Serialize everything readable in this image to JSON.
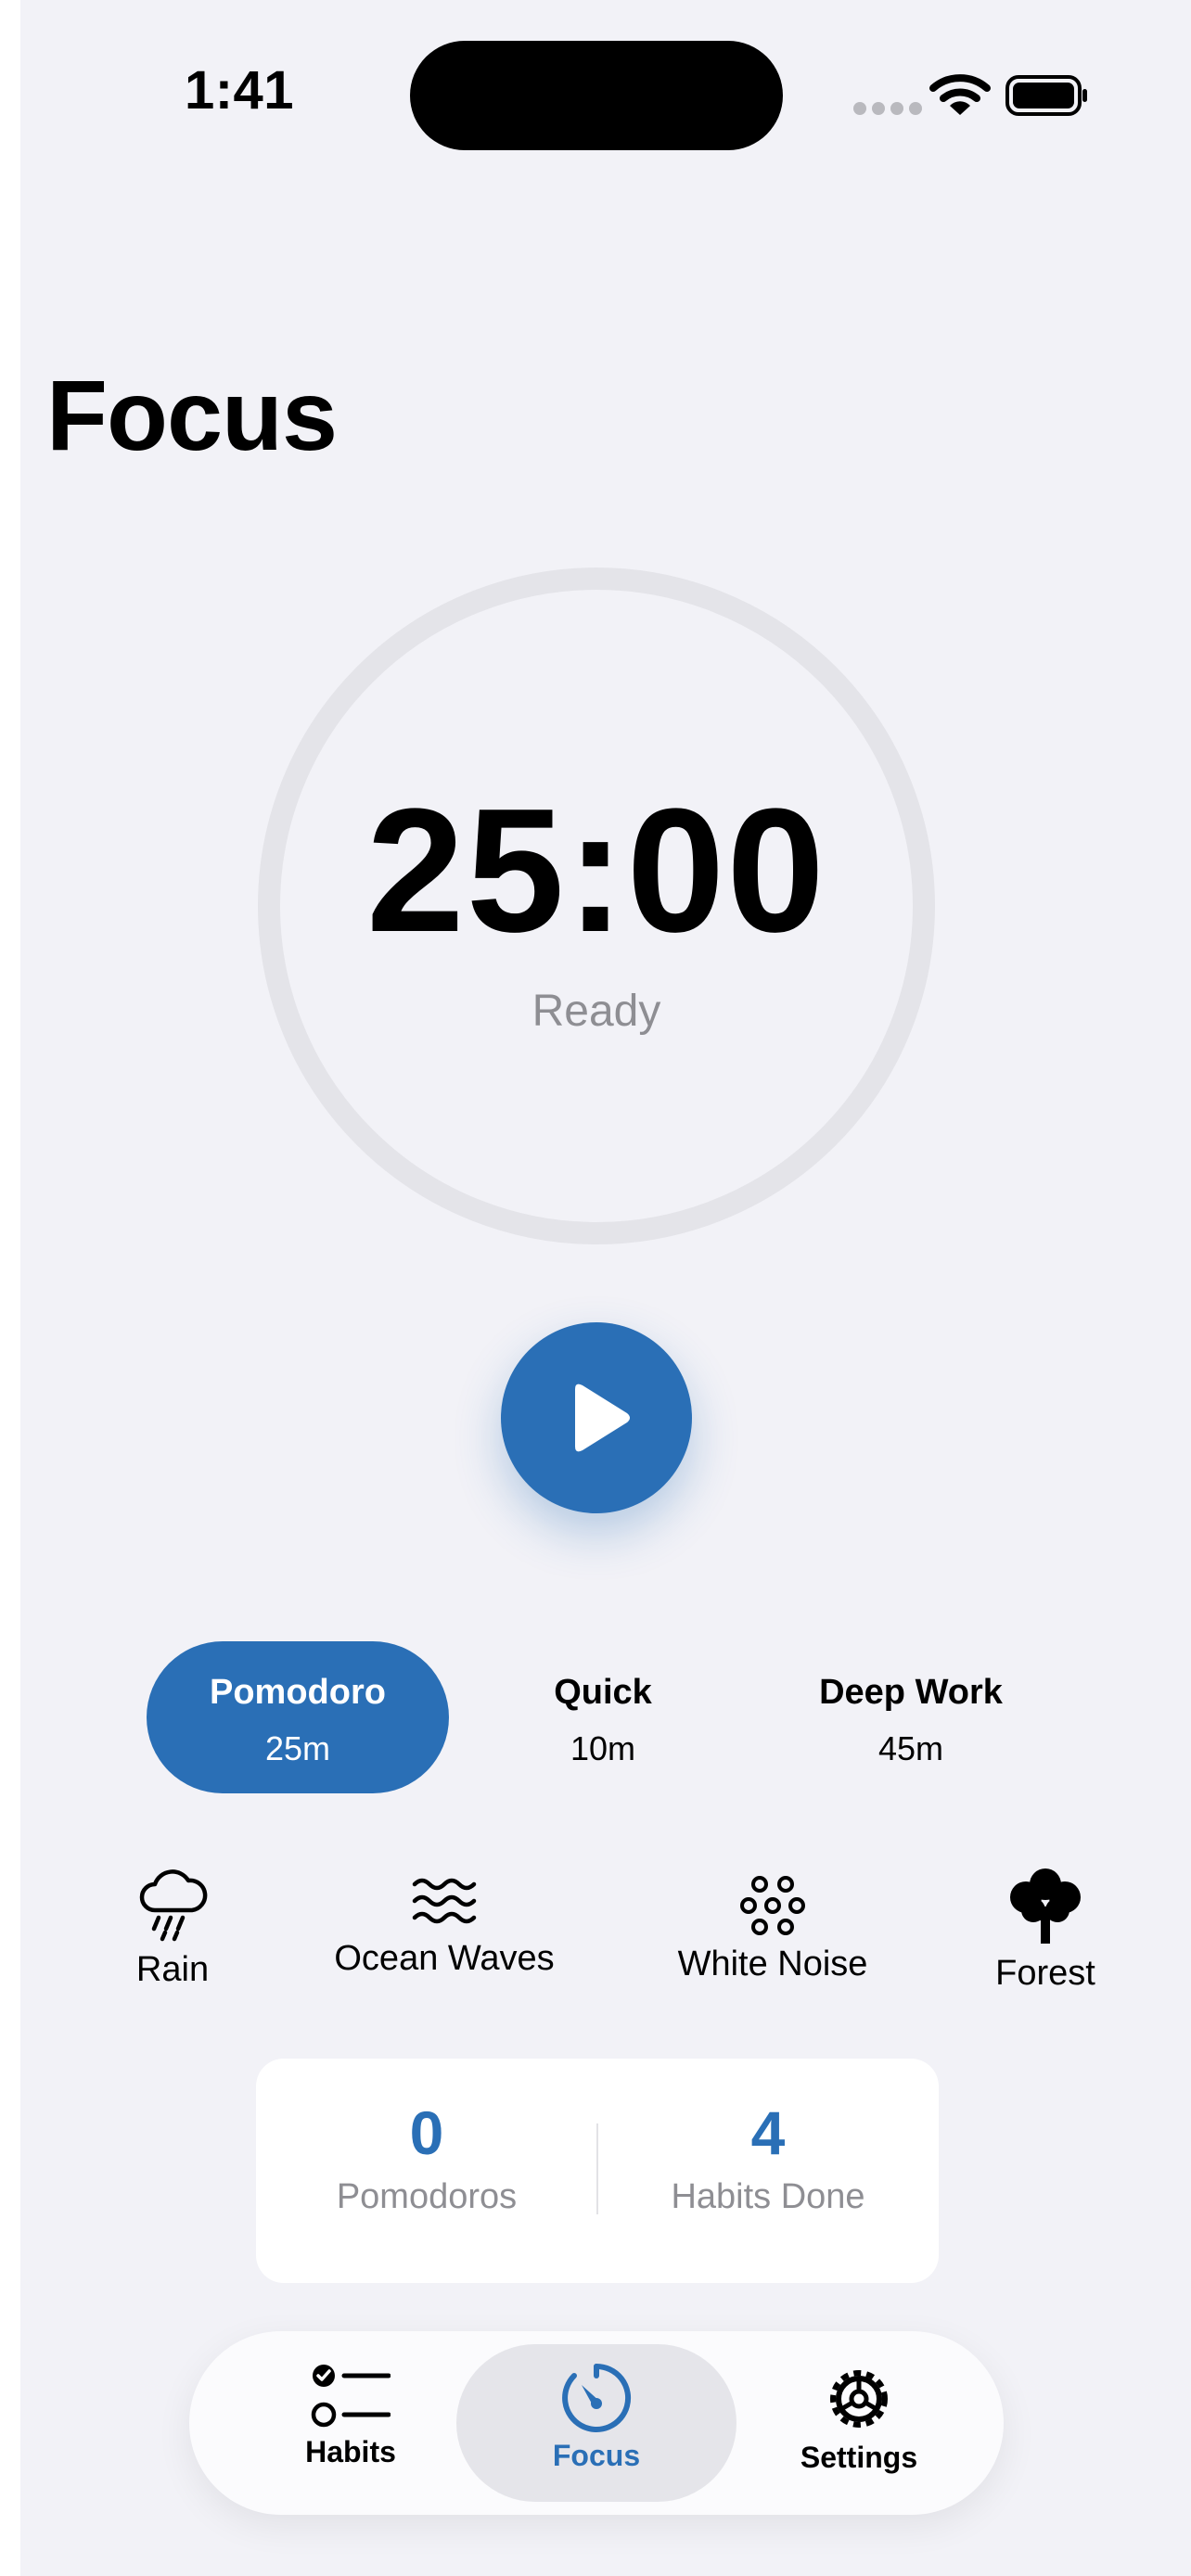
{
  "status_bar": {
    "time": "1:41"
  },
  "page": {
    "title": "Focus"
  },
  "timer": {
    "value": "25:00",
    "status": "Ready"
  },
  "colors": {
    "accent": "#2a6fb6",
    "background": "#f2f2f7",
    "ring": "#e4e4e9",
    "secondary_text": "#8e8e93"
  },
  "presets": [
    {
      "name": "Pomodoro",
      "duration": "25m",
      "selected": true
    },
    {
      "name": "Quick",
      "duration": "10m",
      "selected": false
    },
    {
      "name": "Deep Work",
      "duration": "45m",
      "selected": false
    }
  ],
  "sounds": [
    {
      "label": "Rain",
      "icon": "cloud-rain-icon"
    },
    {
      "label": "Ocean Waves",
      "icon": "waves-icon"
    },
    {
      "label": "White Noise",
      "icon": "circles-grid-icon"
    },
    {
      "label": "Forest",
      "icon": "tree-icon"
    }
  ],
  "stats": [
    {
      "value": "0",
      "label": "Pomodoros"
    },
    {
      "value": "4",
      "label": "Habits Done"
    }
  ],
  "tabs": [
    {
      "label": "Habits",
      "icon": "checklist-icon",
      "active": false
    },
    {
      "label": "Focus",
      "icon": "timer-icon",
      "active": true
    },
    {
      "label": "Settings",
      "icon": "gear-icon",
      "active": false
    }
  ]
}
